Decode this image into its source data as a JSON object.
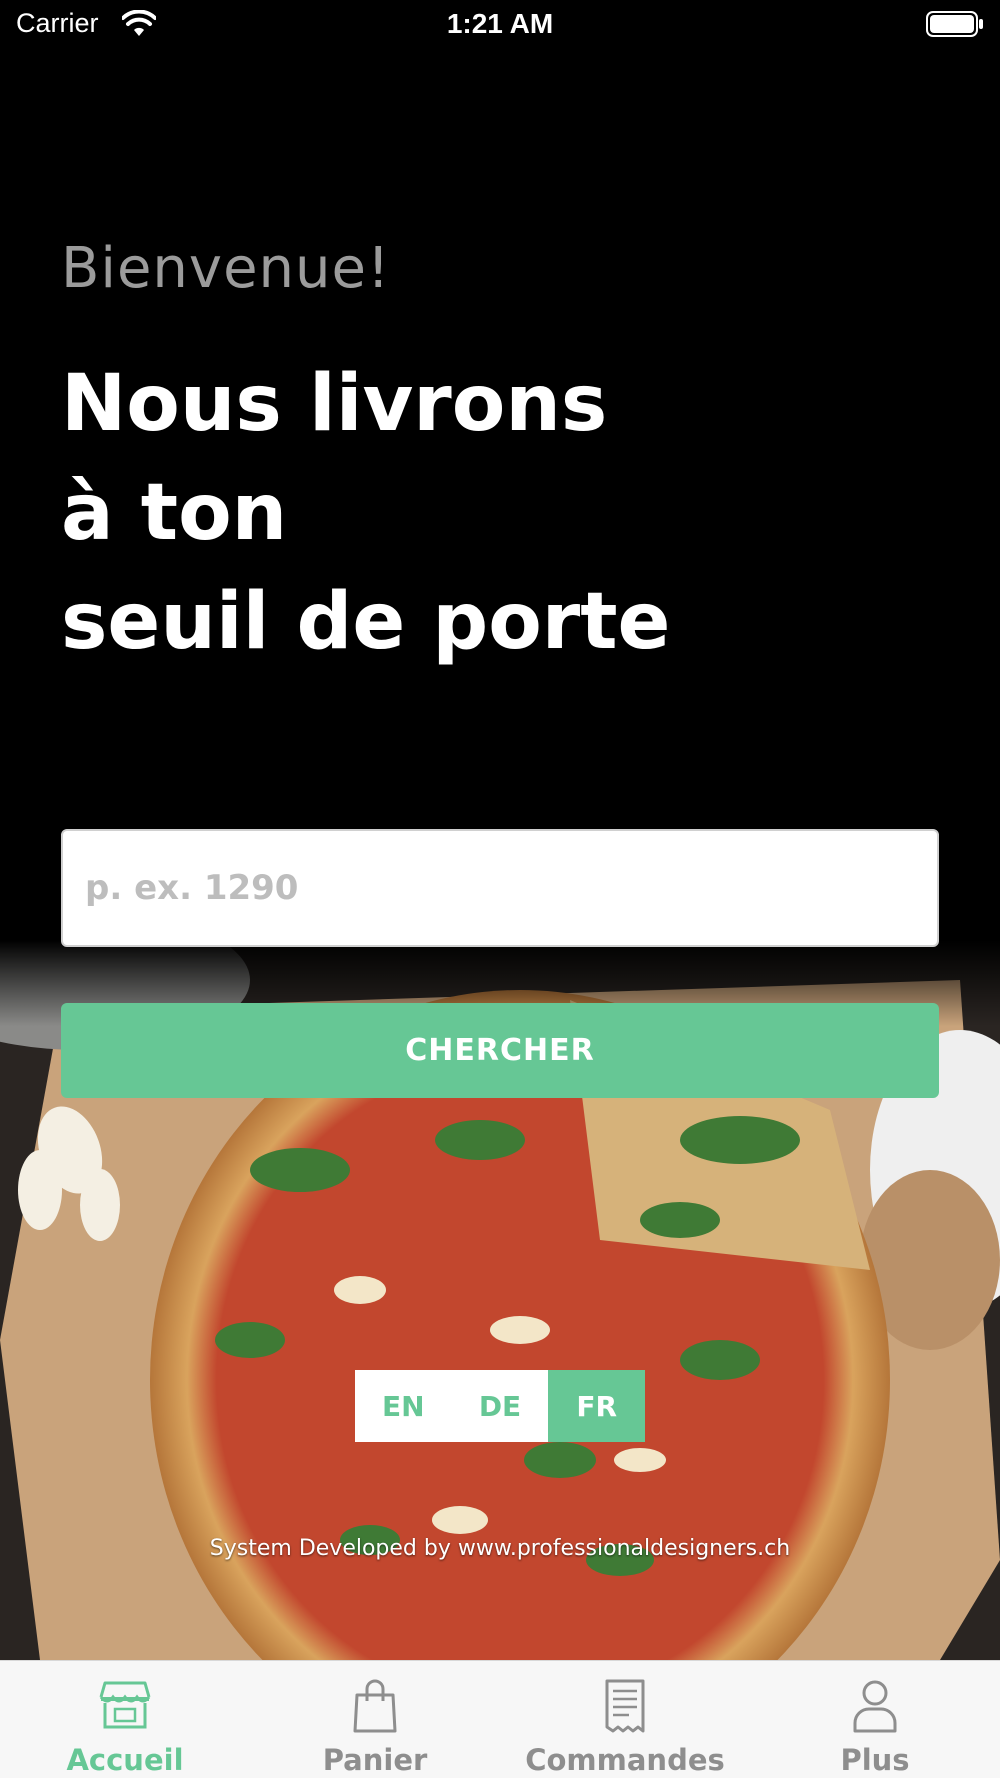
{
  "status_bar": {
    "carrier": "Carrier",
    "time": "1:21 AM"
  },
  "hero": {
    "greeting": "Bienvenue!",
    "headline_lines": [
      "Nous livrons",
      "à ton",
      "seuil de porte"
    ]
  },
  "search": {
    "placeholder": "p. ex. 1290",
    "value": "",
    "button_label": "CHERCHER"
  },
  "languages": [
    {
      "label": "EN",
      "active": false
    },
    {
      "label": "DE",
      "active": false
    },
    {
      "label": "FR",
      "active": true
    }
  ],
  "footer": {
    "credit": "System Developed by www.professionaldesigners.ch"
  },
  "tab_bar": [
    {
      "label": "Accueil",
      "icon": "store-icon",
      "active": true
    },
    {
      "label": "Panier",
      "icon": "shopping-bag-icon",
      "active": false
    },
    {
      "label": "Commandes",
      "icon": "receipt-icon",
      "active": false
    },
    {
      "label": "Plus",
      "icon": "person-icon",
      "active": false
    }
  ],
  "colors": {
    "accent": "#66c795",
    "background": "#000000",
    "tab_inactive": "#8e8e8e"
  }
}
